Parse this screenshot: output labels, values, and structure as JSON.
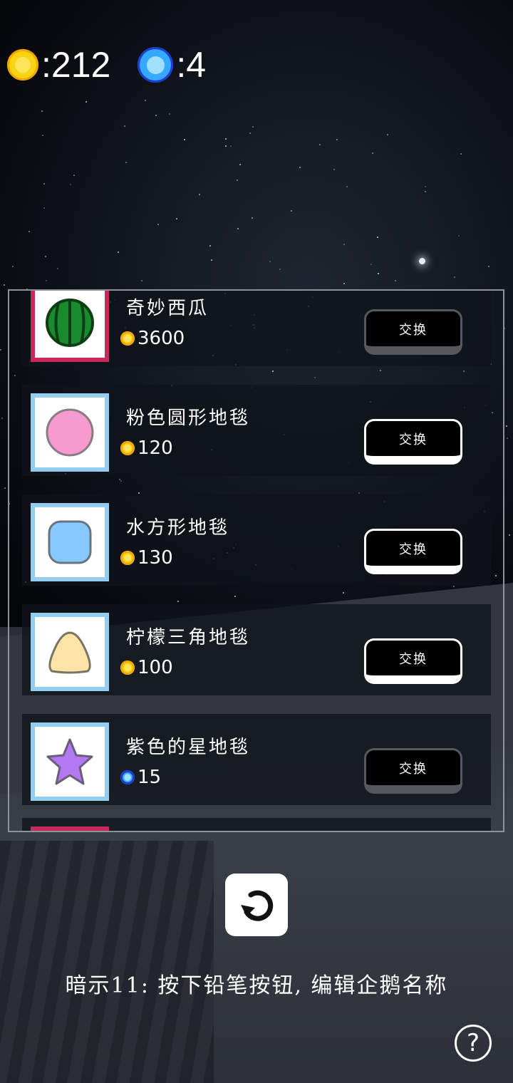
{
  "hud": {
    "coin_icon": "gold-coin-icon",
    "coins": ":212",
    "gem_icon": "blue-gem-icon",
    "gems": ":4"
  },
  "shop": {
    "items": [
      {
        "name": "奇妙西瓜",
        "price": "3600",
        "currency": "coin",
        "icon": "watermelon-icon",
        "button": "交换",
        "enabled": false
      },
      {
        "name": "粉色圆形地毯",
        "price": "120",
        "currency": "coin",
        "icon": "pink-circle-rug-icon",
        "button": "交换",
        "enabled": true
      },
      {
        "name": "水方形地毯",
        "price": "130",
        "currency": "coin",
        "icon": "blue-square-rug-icon",
        "button": "交换",
        "enabled": true
      },
      {
        "name": "柠檬三角地毯",
        "price": "100",
        "currency": "coin",
        "icon": "yellow-triangle-rug-icon",
        "button": "交换",
        "enabled": true
      },
      {
        "name": "紫色的星地毯",
        "price": "15",
        "currency": "gem",
        "icon": "purple-star-rug-icon",
        "button": "交换",
        "enabled": false
      }
    ]
  },
  "hint": "暗示11: 按下铅笔按钮, 编辑企鹅名称",
  "help_label": "?",
  "colors": {
    "coin": "#f8d414",
    "gem": "#35a8ff",
    "pink_frame": "#c8285a",
    "blue_frame": "#93cdf0"
  }
}
